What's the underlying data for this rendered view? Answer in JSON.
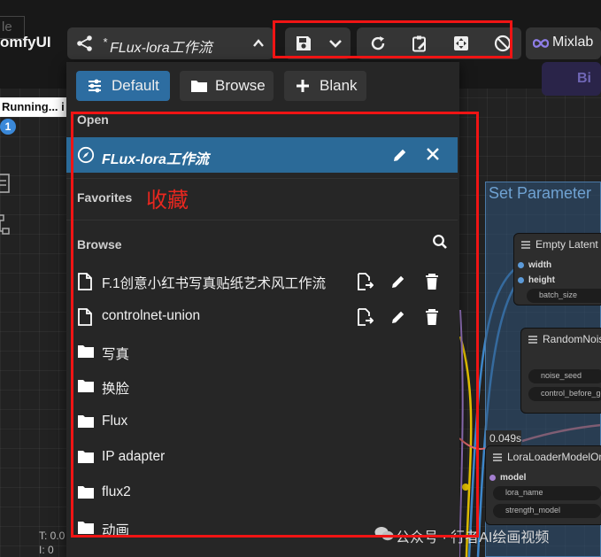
{
  "app": {
    "title": "omfyUI",
    "ghost_label": "le"
  },
  "workflow": {
    "modified_marker": "*",
    "name": "FLux-lora工作流"
  },
  "toolbar": {
    "mixlab_label": "Mixlab",
    "bi_label": "Bi"
  },
  "left_status": {
    "running": "Running... i",
    "queue_count": "1",
    "t_label": "T: 0.0",
    "i_label": "I: 0"
  },
  "panel": {
    "tabs": [
      {
        "label": "Default",
        "icon": "sliders-icon",
        "active": true
      },
      {
        "label": "Browse",
        "icon": "folder-icon"
      },
      {
        "label": "Blank",
        "icon": "plus-icon"
      }
    ],
    "open_label": "Open",
    "open_item": "FLux-lora工作流",
    "favorites_label": "Favorites",
    "favorites_annotation": "收藏",
    "browse_label": "Browse",
    "files": [
      "F.1创意小红书写真贴纸艺术风工作流",
      "controlnet-union"
    ],
    "folders": [
      "写真",
      "换脸",
      "Flux",
      "IP adapter",
      "flux2",
      "动画"
    ]
  },
  "graph": {
    "group_title": "Set Parameter",
    "empty_latent": {
      "title": "Empty Latent I",
      "outputs": [
        "width",
        "height"
      ],
      "widget": "batch_size"
    },
    "random_noise": {
      "title": "RandomNois",
      "widgets": [
        "noise_seed",
        "control_before_ge"
      ]
    },
    "lora_loader": {
      "title": "LoraLoaderModelOnl",
      "input": "model",
      "widgets": [
        "lora_name",
        "strength_model"
      ]
    },
    "timer": "0.049s"
  },
  "watermark": "公众号 · 行者AI绘画视频",
  "colors": {
    "accent": "#2d6da1",
    "selected_row": "#2b6a98",
    "annotation_red": "#f01414",
    "group_blue": "#30547a"
  }
}
